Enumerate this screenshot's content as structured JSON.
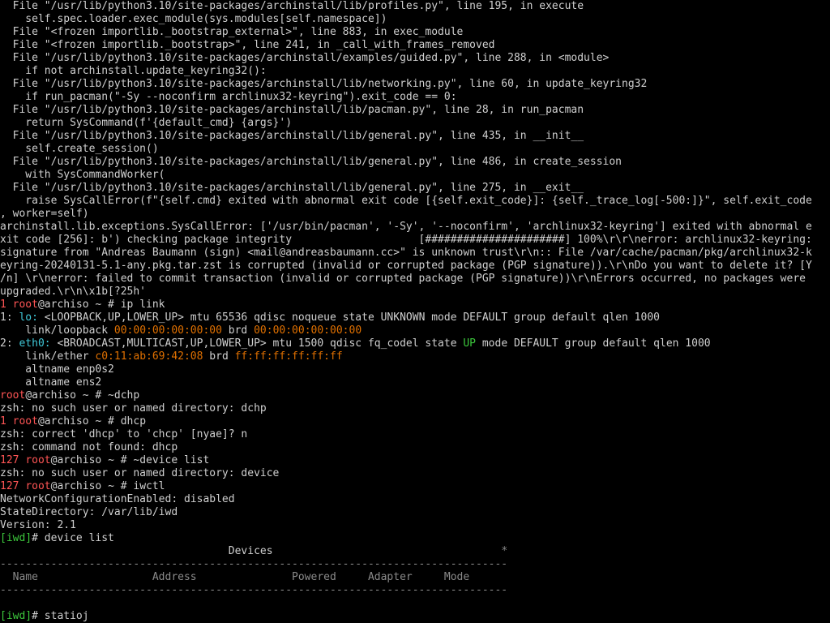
{
  "palette": {
    "w": "#cfcfcf",
    "r": "#ff5555",
    "b": "#5fafff",
    "c": "#3fc8d8",
    "o": "#e07000",
    "g": "#3cc83c",
    "gr": "#8a8a8a"
  },
  "lines": [
    [
      {
        "t": "  File \"/usr/lib/python3.10/site-packages/archinstall/lib/profiles.py\", line 195, in execute",
        "c": "w"
      }
    ],
    [
      {
        "t": "    self.spec.loader.exec_module(sys.modules[self.namespace])",
        "c": "w"
      }
    ],
    [
      {
        "t": "  File \"<frozen importlib._bootstrap_external>\", line 883, in exec_module",
        "c": "w"
      }
    ],
    [
      {
        "t": "  File \"<frozen importlib._bootstrap>\", line 241, in _call_with_frames_removed",
        "c": "w"
      }
    ],
    [
      {
        "t": "  File \"/usr/lib/python3.10/site-packages/archinstall/examples/guided.py\", line 288, in <module>",
        "c": "w"
      }
    ],
    [
      {
        "t": "    if not archinstall.update_keyring32():",
        "c": "w"
      }
    ],
    [
      {
        "t": "  File \"/usr/lib/python3.10/site-packages/archinstall/lib/networking.py\", line 60, in update_keyring32",
        "c": "w"
      }
    ],
    [
      {
        "t": "    if run_pacman(\"-Sy --noconfirm archlinux32-keyring\").exit_code == 0:",
        "c": "w"
      }
    ],
    [
      {
        "t": "  File \"/usr/lib/python3.10/site-packages/archinstall/lib/pacman.py\", line 28, in run_pacman",
        "c": "w"
      }
    ],
    [
      {
        "t": "    return SysCommand(f'{default_cmd} {args}')",
        "c": "w"
      }
    ],
    [
      {
        "t": "  File \"/usr/lib/python3.10/site-packages/archinstall/lib/general.py\", line 435, in __init__",
        "c": "w"
      }
    ],
    [
      {
        "t": "    self.create_session()",
        "c": "w"
      }
    ],
    [
      {
        "t": "  File \"/usr/lib/python3.10/site-packages/archinstall/lib/general.py\", line 486, in create_session",
        "c": "w"
      }
    ],
    [
      {
        "t": "    with SysCommandWorker(",
        "c": "w"
      }
    ],
    [
      {
        "t": "  File \"/usr/lib/python3.10/site-packages/archinstall/lib/general.py\", line 275, in __exit__",
        "c": "w"
      }
    ],
    [
      {
        "t": "    raise SysCallError(f\"{self.cmd} exited with abnormal exit code [{self.exit_code}]: {self._trace_log[-500:]}\", self.exit_code",
        "c": "w"
      }
    ],
    [
      {
        "t": ", worker=self)",
        "c": "w"
      }
    ],
    [
      {
        "t": "archinstall.lib.exceptions.SysCallError: ['/usr/bin/pacman', '-Sy', '--noconfirm', 'archlinux32-keyring'] exited with abnormal e",
        "c": "w"
      }
    ],
    [
      {
        "t": "xit code [256]: b') checking package integrity                    [######################] 100%\\r\\r\\nerror: archlinux32-keyring:",
        "c": "w"
      }
    ],
    [
      {
        "t": "signature from \"Andreas Baumann (sign) <mail@andreasbaumann.cc>\" is unknown trust\\r\\n:: File /var/cache/pacman/pkg/archlinux32-k",
        "c": "w"
      }
    ],
    [
      {
        "t": "eyring-20240131-5.1-any.pkg.tar.zst is corrupted (invalid or corrupted package (PGP signature)).\\r\\nDo you want to delete it? [Y",
        "c": "w"
      }
    ],
    [
      {
        "t": "/n] \\r\\nerror: failed to commit transaction (invalid or corrupted package (PGP signature))\\r\\nErrors occurred, no packages were",
        "c": "w"
      }
    ],
    [
      {
        "t": "upgraded.\\r\\n\\x1b[?25h'",
        "c": "w"
      }
    ],
    [
      {
        "t": "1 ",
        "c": "r"
      },
      {
        "t": "root",
        "c": "r"
      },
      {
        "t": "@archiso ~ # ip link",
        "c": "w"
      }
    ],
    [
      {
        "t": "1: ",
        "c": "w"
      },
      {
        "t": "lo:",
        "c": "c"
      },
      {
        "t": " <LOOPBACK,UP,LOWER_UP> mtu 65536 qdisc noqueue state UNKNOWN mode DEFAULT group default qlen 1000",
        "c": "w"
      }
    ],
    [
      {
        "t": "    link/loopback ",
        "c": "w"
      },
      {
        "t": "00:00:00:00:00:00",
        "c": "o"
      },
      {
        "t": " brd ",
        "c": "w"
      },
      {
        "t": "00:00:00:00:00:00",
        "c": "o"
      }
    ],
    [
      {
        "t": "2: ",
        "c": "w"
      },
      {
        "t": "eth0:",
        "c": "c"
      },
      {
        "t": " <BROADCAST,MULTICAST,UP,LOWER_UP> mtu 1500 qdisc fq_codel state ",
        "c": "w"
      },
      {
        "t": "UP",
        "c": "g"
      },
      {
        "t": " mode DEFAULT group default qlen 1000",
        "c": "w"
      }
    ],
    [
      {
        "t": "    link/ether ",
        "c": "w"
      },
      {
        "t": "c0:11:ab:69:42:08",
        "c": "o"
      },
      {
        "t": " brd ",
        "c": "w"
      },
      {
        "t": "ff:ff:ff:ff:ff:ff",
        "c": "o"
      }
    ],
    [
      {
        "t": "    altname enp0s2",
        "c": "w"
      }
    ],
    [
      {
        "t": "    altname ens2",
        "c": "w"
      }
    ],
    [
      {
        "t": "root",
        "c": "r"
      },
      {
        "t": "@archiso ~ # ~dchp",
        "c": "w"
      }
    ],
    [
      {
        "t": "zsh: no such user or named directory: dchp",
        "c": "w"
      }
    ],
    [
      {
        "t": "1 ",
        "c": "r"
      },
      {
        "t": "root",
        "c": "r"
      },
      {
        "t": "@archiso ~ # dhcp",
        "c": "w"
      }
    ],
    [
      {
        "t": "zsh: correct 'dhcp' to 'chcp' [nyae]? n",
        "c": "w"
      }
    ],
    [
      {
        "t": "zsh: command not found: dhcp",
        "c": "w"
      }
    ],
    [
      {
        "t": "127 ",
        "c": "r"
      },
      {
        "t": "root",
        "c": "r"
      },
      {
        "t": "@archiso ~ # ~device list",
        "c": "w"
      }
    ],
    [
      {
        "t": "zsh: no such user or named directory: device",
        "c": "w"
      }
    ],
    [
      {
        "t": "127 ",
        "c": "r"
      },
      {
        "t": "root",
        "c": "r"
      },
      {
        "t": "@archiso ~ # iwctl",
        "c": "w"
      }
    ],
    [
      {
        "t": "NetworkConfigurationEnabled: disabled",
        "c": "w"
      }
    ],
    [
      {
        "t": "StateDirectory: /var/lib/iwd",
        "c": "w"
      }
    ],
    [
      {
        "t": "Version: 2.1",
        "c": "w"
      }
    ],
    [
      {
        "t": "[iwd]",
        "c": "g"
      },
      {
        "t": "# device list",
        "c": "w"
      }
    ],
    [
      {
        "t": "                                    Devices                                    ",
        "c": "w"
      },
      {
        "t": "*",
        "c": "gr"
      }
    ],
    [
      {
        "t": "--------------------------------------------------------------------------------",
        "c": "gr"
      }
    ],
    [
      {
        "t": "  Name                  Address               Powered     Adapter     Mode",
        "c": "gr"
      }
    ],
    [
      {
        "t": "--------------------------------------------------------------------------------",
        "c": "gr"
      }
    ],
    [
      {
        "t": "",
        "c": "w"
      }
    ],
    [
      {
        "t": "[iwd]",
        "c": "g"
      },
      {
        "t": "# statioj",
        "c": "w"
      }
    ]
  ]
}
